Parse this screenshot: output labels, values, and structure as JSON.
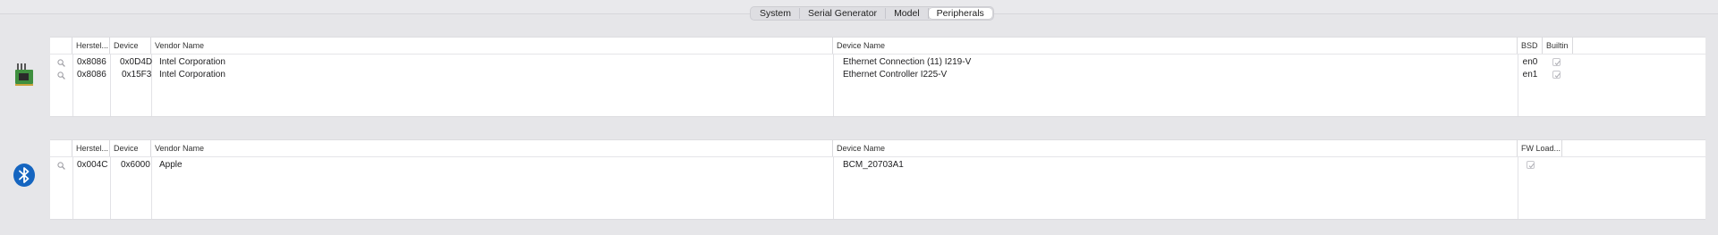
{
  "tabs": [
    {
      "label": "System",
      "active": false
    },
    {
      "label": "Serial Generator",
      "active": false
    },
    {
      "label": "Model",
      "active": false
    },
    {
      "label": "Peripherals",
      "active": true
    }
  ],
  "network": {
    "icon": "network-card-icon",
    "columns": [
      "Herstel...",
      "Device",
      "Vendor Name",
      "Device Name",
      "BSD",
      "Builtin"
    ],
    "rows": [
      {
        "vendor_id": "0x8086",
        "device_id": "0x0D4D",
        "vendor_name": "Intel Corporation",
        "device_name": "Ethernet Connection (11) I219-V",
        "bsd": "en0",
        "builtin": true
      },
      {
        "vendor_id": "0x8086",
        "device_id": "0x15F3",
        "vendor_name": "Intel Corporation",
        "device_name": "Ethernet Controller I225-V",
        "bsd": "en1",
        "builtin": true
      }
    ]
  },
  "bluetooth": {
    "icon": "bluetooth-icon",
    "columns": [
      "Herstel...",
      "Device",
      "Vendor Name",
      "Device Name",
      "FW Load..."
    ],
    "rows": [
      {
        "vendor_id": "0x004C",
        "device_id": "0x6000",
        "vendor_name": "Apple",
        "device_name": "BCM_20703A1",
        "fw_load": true
      }
    ]
  },
  "colors": {
    "bluetooth": "#1565c0",
    "card_green": "#3f8f3f",
    "check": "#b0b0b6"
  }
}
